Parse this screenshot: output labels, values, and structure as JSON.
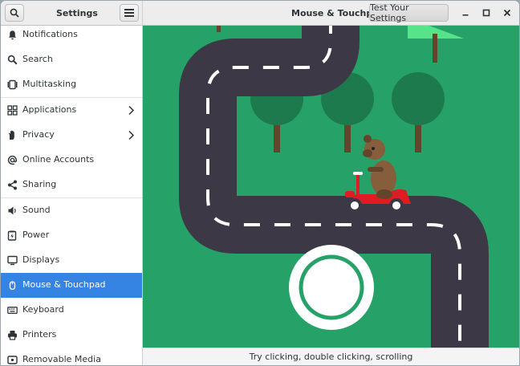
{
  "app": {
    "sidebar_title": "Settings",
    "page_title": "Mouse & Touchpad",
    "test_button_label": "Test Your Settings"
  },
  "sidebar": {
    "items": [
      {
        "label": "Notifications",
        "icon": "bell-icon"
      },
      {
        "label": "Search",
        "icon": "search-icon"
      },
      {
        "label": "Multitasking",
        "icon": "multitasking-icon"
      },
      {
        "label": "Applications",
        "icon": "grid-icon",
        "has_chevron": true
      },
      {
        "label": "Privacy",
        "icon": "hand-icon",
        "has_chevron": true
      },
      {
        "label": "Online Accounts",
        "icon": "at-icon"
      },
      {
        "label": "Sharing",
        "icon": "share-icon"
      },
      {
        "label": "Sound",
        "icon": "speaker-icon"
      },
      {
        "label": "Power",
        "icon": "power-icon"
      },
      {
        "label": "Displays",
        "icon": "monitor-icon"
      },
      {
        "label": "Mouse & Touchpad",
        "icon": "mouse-icon",
        "active": true
      },
      {
        "label": "Keyboard",
        "icon": "keyboard-icon"
      },
      {
        "label": "Printers",
        "icon": "printer-icon"
      },
      {
        "label": "Removable Media",
        "icon": "media-icon"
      }
    ]
  },
  "test_area": {
    "hint_text": "Try clicking, double clicking, scrolling",
    "background_color": "#26a269",
    "road_color": "#3d3846",
    "accent_color": "#3584e4"
  }
}
